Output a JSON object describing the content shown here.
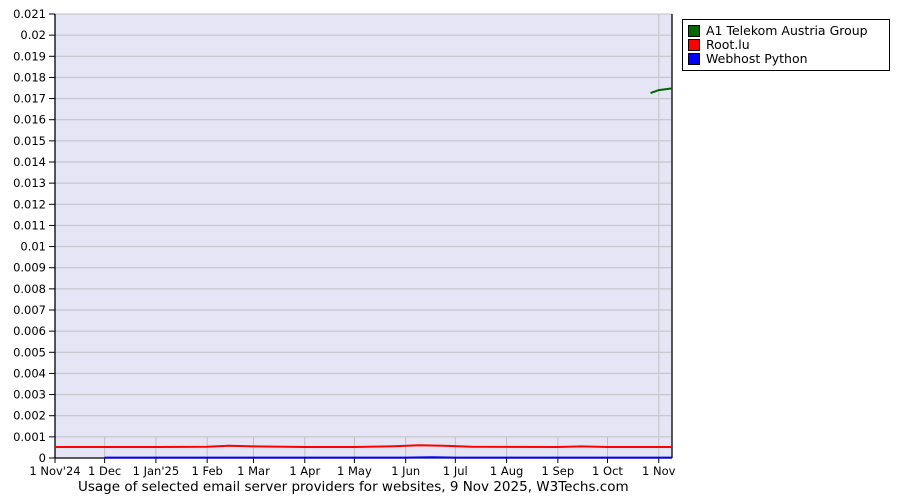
{
  "window": {
    "background": "#ffffff"
  },
  "chart_data": {
    "type": "line",
    "title": "Usage of selected email server providers for websites, 9 Nov 2025, W3Techs.com",
    "ylabel": "",
    "xlabel": "",
    "ylim": [
      0,
      0.021
    ],
    "y_tick_step": 0.001,
    "y_tick_labels": [
      "0",
      "0.001",
      "0.002",
      "0.003",
      "0.004",
      "0.005",
      "0.006",
      "0.007",
      "0.008",
      "0.009",
      "0.01",
      "0.011",
      "0.012",
      "0.013",
      "0.014",
      "0.015",
      "0.016",
      "0.017",
      "0.018",
      "0.019",
      "0.02",
      "0.021"
    ],
    "x_domain_days": [
      0,
      373
    ],
    "x_ticks": [
      {
        "label": "1 Nov'24",
        "day": 0
      },
      {
        "label": "1 Dec",
        "day": 30
      },
      {
        "label": "1 Jan'25",
        "day": 61
      },
      {
        "label": "1 Feb",
        "day": 92
      },
      {
        "label": "1 Mar",
        "day": 120
      },
      {
        "label": "1 Apr",
        "day": 151
      },
      {
        "label": "1 May",
        "day": 181
      },
      {
        "label": "1 Jun",
        "day": 212
      },
      {
        "label": "1 Jul",
        "day": 242
      },
      {
        "label": "1 Aug",
        "day": 273
      },
      {
        "label": "1 Sep",
        "day": 304
      },
      {
        "label": "1 Oct",
        "day": 334
      },
      {
        "label": "1 Nov",
        "day": 365
      }
    ],
    "grid": true,
    "legend_position": "top-right",
    "colors": {
      "plot_bg": "#e5e5f5",
      "grid": "#c0c0c4",
      "axis": "#000000",
      "text": "#000000"
    },
    "series": [
      {
        "name": "A1 Telekom Austria Group",
        "color": "#006600",
        "points": [
          [
            360,
            0.01726
          ],
          [
            365,
            0.0174
          ],
          [
            373,
            0.01748
          ]
        ]
      },
      {
        "name": "Root.lu",
        "color": "#ff0000",
        "points": [
          [
            0,
            0.00052
          ],
          [
            61,
            0.00052
          ],
          [
            92,
            0.00053
          ],
          [
            105,
            0.00058
          ],
          [
            120,
            0.00055
          ],
          [
            151,
            0.00052
          ],
          [
            181,
            0.00052
          ],
          [
            205,
            0.00056
          ],
          [
            220,
            0.0006
          ],
          [
            235,
            0.00058
          ],
          [
            252,
            0.00053
          ],
          [
            304,
            0.00052
          ],
          [
            318,
            0.00055
          ],
          [
            334,
            0.00052
          ],
          [
            373,
            0.00052
          ]
        ]
      },
      {
        "name": "Webhost Python",
        "color": "#0000ff",
        "points": [
          [
            30,
            2e-05
          ],
          [
            212,
            2e-05
          ],
          [
            228,
            4e-05
          ],
          [
            242,
            2e-05
          ],
          [
            373,
            2e-05
          ]
        ]
      }
    ]
  }
}
